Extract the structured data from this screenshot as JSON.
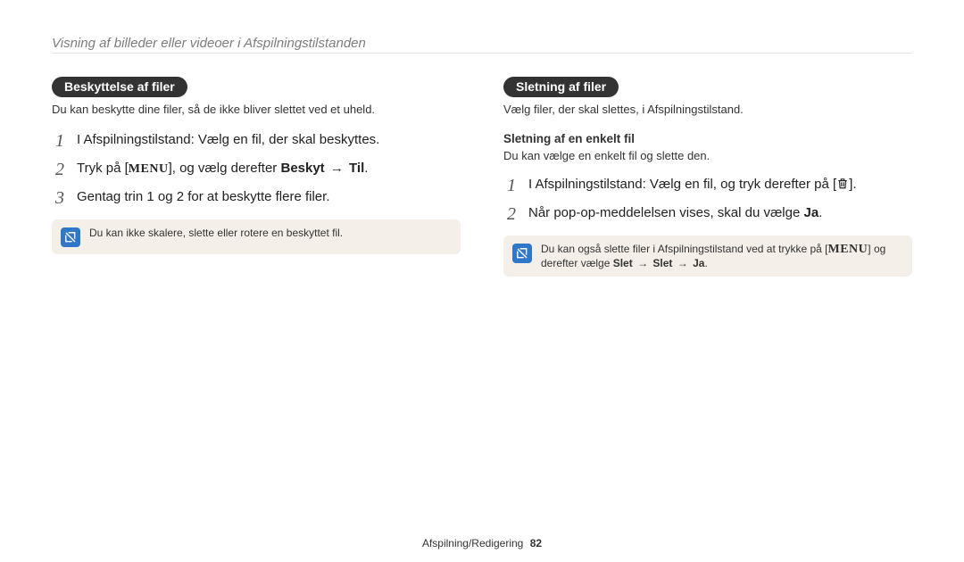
{
  "header": "Visning af billeder eller videoer i Afspilningstilstanden",
  "left": {
    "pill": "Beskyttelse af filer",
    "intro": "Du kan beskytte dine filer, så de ikke bliver slettet ved et uheld.",
    "step1_num": "1",
    "step1_text": "I Afspilningstilstand: Vælg en fil, der skal beskyttes.",
    "step2_num": "2",
    "step2_pre": "Tryk på [",
    "step2_menu": "MENU",
    "step2_mid": "], og vælg derefter ",
    "step2_b1": "Beskyt",
    "step2_arrow": " → ",
    "step2_b2": "Til",
    "step2_end": ".",
    "step3_num": "3",
    "step3_text": "Gentag trin 1 og 2 for at beskytte flere filer.",
    "note_text": "Du kan ikke skalere, slette eller rotere en beskyttet fil."
  },
  "right": {
    "pill": "Sletning af filer",
    "intro": "Vælg filer, der skal slettes, i Afspilningstilstand.",
    "sub_head": "Sletning af en enkelt fil",
    "sub_intro": "Du kan vælge en enkelt fil og slette den.",
    "step1_num": "1",
    "step1_pre": "I Afspilningstilstand: Vælg en fil, og tryk derefter på [",
    "step1_post": "].",
    "step2_num": "2",
    "step2_pre": "Når pop-op-meddelelsen vises, skal du vælge ",
    "step2_b": "Ja",
    "step2_end": ".",
    "note_pre": "Du kan også slette filer i Afspilningstilstand ved at trykke på [",
    "note_menu": "MENU",
    "note_mid": "] og derefter vælge ",
    "note_b1": "Slet",
    "note_arrow1": " → ",
    "note_b2": "Slet",
    "note_arrow2": " → ",
    "note_b3": "Ja",
    "note_end": "."
  },
  "footer": {
    "section": "Afspilning/Redigering",
    "page": "82"
  }
}
